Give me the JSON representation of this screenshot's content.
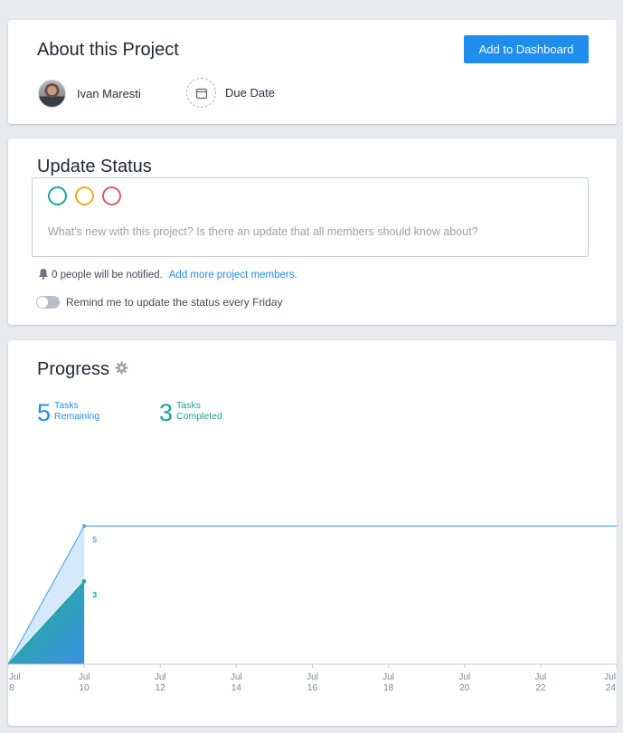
{
  "about": {
    "title": "About this Project",
    "dashboard_button": "Add to Dashboard",
    "owner_name": "Ivan Maresti",
    "due_label": "Due Date"
  },
  "status": {
    "title": "Update Status",
    "placeholder": "What's new with this project? Is there an update that all members should know about?",
    "notify_text": "0 people will be notified.",
    "add_members_link": "Add more project members.",
    "remind_label": "Remind me to update the status every Friday",
    "status_colors": [
      "#17a59a",
      "#f0ad1e",
      "#e0585f"
    ]
  },
  "progress": {
    "title": "Progress",
    "remaining_count": "5",
    "remaining_label_1": "Tasks",
    "remaining_label_2": "Remaining",
    "completed_count": "3",
    "completed_label_1": "Tasks",
    "completed_label_2": "Completed"
  },
  "chart_data": {
    "type": "area",
    "x_month": "Jul",
    "x_ticks": [
      "8",
      "10",
      "12",
      "14",
      "16",
      "18",
      "20",
      "22",
      "24"
    ],
    "series": [
      {
        "name": "Tasks Remaining",
        "color": "#5aa9ee",
        "points": [
          {
            "x": 8,
            "y": 0
          },
          {
            "x": 10,
            "y": 5
          },
          {
            "x": 24,
            "y": 5
          }
        ]
      },
      {
        "name": "Tasks Completed",
        "color": "#17a59a",
        "points": [
          {
            "x": 8,
            "y": 0
          },
          {
            "x": 10,
            "y": 3
          }
        ]
      }
    ],
    "point_labels": [
      {
        "x": 10,
        "y": 5,
        "text": "5",
        "series": 0
      },
      {
        "x": 10,
        "y": 3,
        "text": "3",
        "series": 1
      }
    ],
    "ylim": [
      0,
      7.3
    ],
    "xlim": [
      8,
      24
    ],
    "grid": false
  }
}
